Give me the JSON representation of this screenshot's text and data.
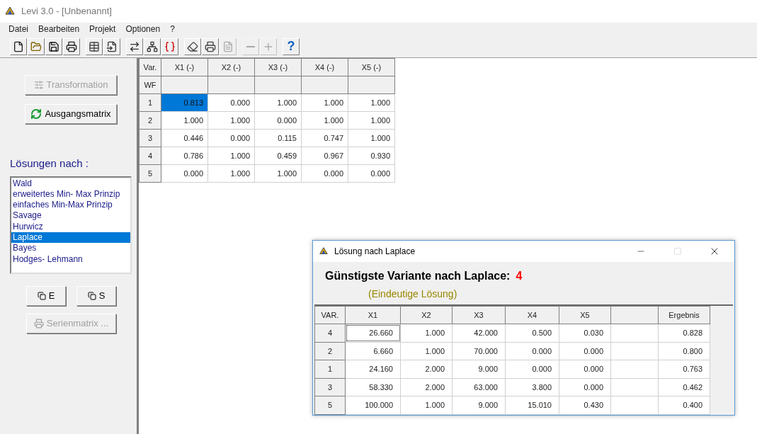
{
  "window": {
    "title": "Levi 3.0 - [Unbenannt]"
  },
  "menu": [
    "Datei",
    "Bearbeiten",
    "Projekt",
    "Optionen",
    "?"
  ],
  "toolbar": [
    [
      {
        "kind": "new",
        "disabled": false
      },
      {
        "kind": "open",
        "disabled": false
      },
      {
        "kind": "save",
        "disabled": false
      },
      {
        "kind": "print",
        "disabled": false
      }
    ],
    [
      {
        "kind": "table",
        "disabled": false
      },
      {
        "kind": "import",
        "disabled": false
      }
    ],
    [
      {
        "kind": "transform",
        "disabled": false
      },
      {
        "kind": "network",
        "disabled": false
      },
      {
        "kind": "braces",
        "disabled": false
      }
    ],
    [
      {
        "kind": "eraser",
        "disabled": false
      },
      {
        "kind": "printer",
        "disabled": false
      },
      {
        "kind": "document",
        "disabled": true
      }
    ],
    [
      {
        "kind": "minus",
        "disabled": true
      },
      {
        "kind": "plus",
        "disabled": true
      }
    ],
    [
      {
        "kind": "help",
        "label": "?",
        "disabled": false
      }
    ]
  ],
  "sidebar": {
    "transformation_button": {
      "label": "Transformation",
      "disabled": true
    },
    "reset_button": {
      "label": "Ausgangsmatrix",
      "disabled": false
    },
    "methods_label": "Lösungen nach :",
    "methods": [
      {
        "label": "Wald",
        "selected": false
      },
      {
        "label": "erweitertes Min- Max Prinzip",
        "selected": false
      },
      {
        "label": "einfaches Min-Max Prinzip",
        "selected": false
      },
      {
        "label": "Savage",
        "selected": false
      },
      {
        "label": "Hurwicz",
        "selected": false
      },
      {
        "label": "Laplace",
        "selected": true
      },
      {
        "label": "Bayes",
        "selected": false
      },
      {
        "label": "Hodges- Lehmann",
        "selected": false
      }
    ],
    "e_button": {
      "label": "E",
      "disabled": false
    },
    "s_button": {
      "label": "S",
      "disabled": false
    },
    "series_button": {
      "label": "Serienmatrix ...",
      "disabled": true
    }
  },
  "matrix": {
    "corner": "Var.",
    "columns": [
      "X1 (-)",
      "X2 (-)",
      "X3 (-)",
      "X4 (-)",
      "X5 (-)"
    ],
    "weight_label": "WF",
    "rows": [
      {
        "var": "1",
        "cells": [
          {
            "value": "0.813",
            "selected": true
          },
          {
            "value": "0.000",
            "selected": false
          },
          {
            "value": "1.000",
            "selected": false
          },
          {
            "value": "1.000",
            "selected": false
          },
          {
            "value": "1.000",
            "selected": false
          }
        ]
      },
      {
        "var": "2",
        "cells": [
          {
            "value": "1.000",
            "selected": false
          },
          {
            "value": "1.000",
            "selected": false
          },
          {
            "value": "0.000",
            "selected": false
          },
          {
            "value": "1.000",
            "selected": false
          },
          {
            "value": "1.000",
            "selected": false
          }
        ]
      },
      {
        "var": "3",
        "cells": [
          {
            "value": "0.446",
            "selected": false
          },
          {
            "value": "0.000",
            "selected": false
          },
          {
            "value": "0.115",
            "selected": false
          },
          {
            "value": "0.747",
            "selected": false
          },
          {
            "value": "1.000",
            "selected": false
          }
        ]
      },
      {
        "var": "4",
        "cells": [
          {
            "value": "0.786",
            "selected": false
          },
          {
            "value": "1.000",
            "selected": false
          },
          {
            "value": "0.459",
            "selected": false
          },
          {
            "value": "0.967",
            "selected": false
          },
          {
            "value": "0.930",
            "selected": false
          }
        ]
      },
      {
        "var": "5",
        "cells": [
          {
            "value": "0.000",
            "selected": false
          },
          {
            "value": "1.000",
            "selected": false
          },
          {
            "value": "1.000",
            "selected": false
          },
          {
            "value": "0.000",
            "selected": false
          },
          {
            "value": "0.000",
            "selected": false
          }
        ]
      }
    ]
  },
  "dialog": {
    "title": "Lösung nach Laplace",
    "maximize_disabled": true,
    "heading": "Günstigste Variante nach Laplace:",
    "best_variant": "4",
    "note": "(Eindeutige Lösung)",
    "columns": [
      {
        "label": "VAR."
      },
      {
        "label": "X1"
      },
      {
        "label": "X2"
      },
      {
        "label": "X3"
      },
      {
        "label": "X4"
      },
      {
        "label": "X5"
      },
      {},
      {
        "label": "Ergebnis"
      }
    ],
    "rows": [
      {
        "var": "4",
        "values": [
          "26.660",
          "1.000",
          "42.000",
          "0.500",
          "0.030"
        ],
        "result": "0.828",
        "focused": true
      },
      {
        "var": "2",
        "values": [
          "6.660",
          "1.000",
          "70.000",
          "0.000",
          "0.000"
        ],
        "result": "0.800",
        "focused": false
      },
      {
        "var": "1",
        "values": [
          "24.160",
          "2.000",
          "9.000",
          "0.000",
          "0.000"
        ],
        "result": "0.763",
        "focused": false
      },
      {
        "var": "3",
        "values": [
          "58.330",
          "2.000",
          "63.000",
          "3.800",
          "0.000"
        ],
        "result": "0.462",
        "focused": false
      },
      {
        "var": "5",
        "values": [
          "100.000",
          "1.000",
          "9.000",
          "15.010",
          "0.430"
        ],
        "result": "0.400",
        "focused": false
      }
    ]
  }
}
